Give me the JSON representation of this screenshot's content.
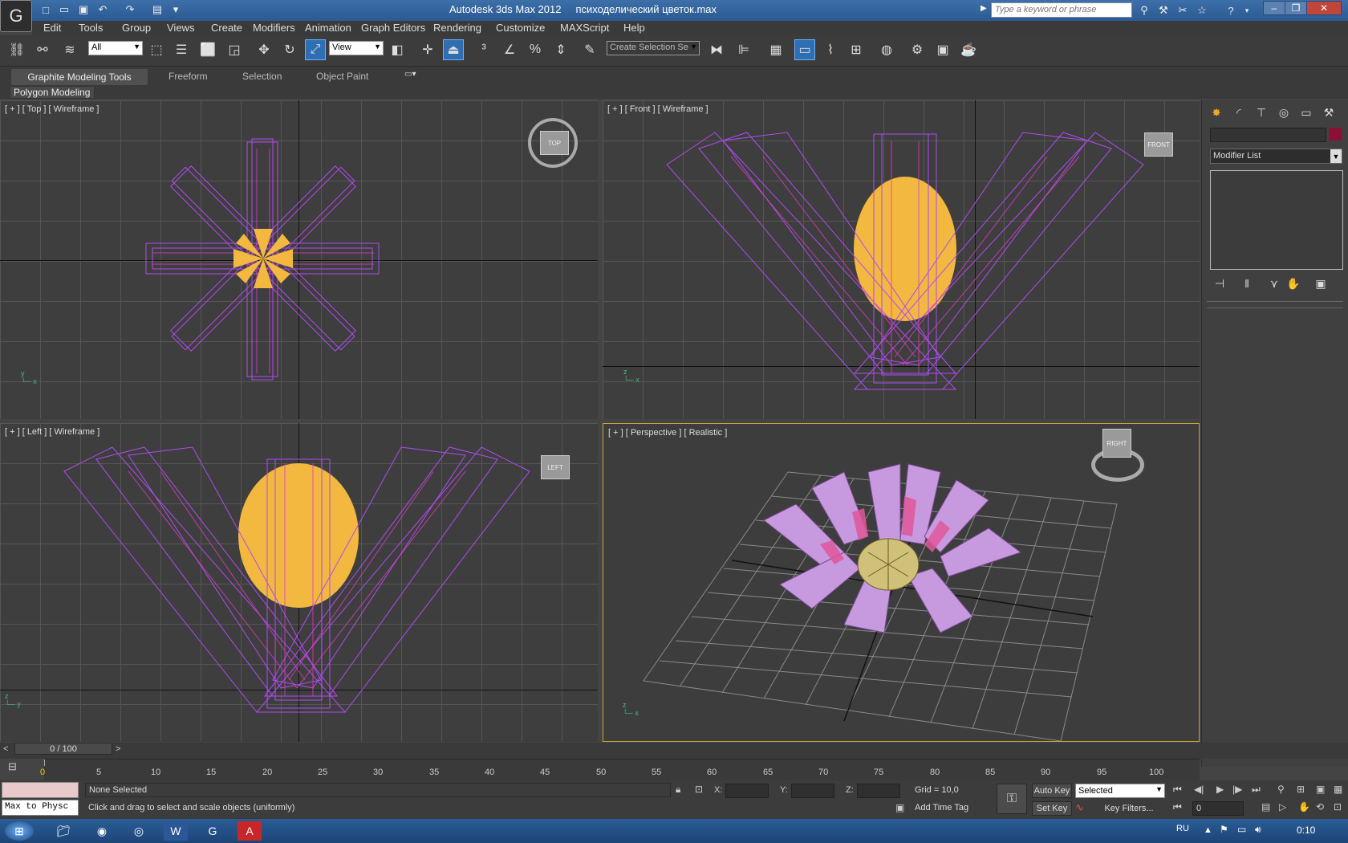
{
  "app": {
    "title": "Autodesk 3ds Max  2012",
    "document": "психоделический цветок.max",
    "search_placeholder": "Type a keyword or phrase"
  },
  "menu": [
    "Edit",
    "Tools",
    "Group",
    "Views",
    "Create",
    "Modifiers",
    "Animation",
    "Graph Editors",
    "Rendering",
    "Customize",
    "MAXScript",
    "Help"
  ],
  "toolbar": {
    "selection_filter": "All",
    "ref_coord": "View",
    "selection_set_placeholder": "Create Selection Se"
  },
  "ribbon": {
    "tabs": [
      "Graphite Modeling Tools",
      "Freeform",
      "Selection",
      "Object Paint"
    ],
    "panel_button": "Polygon Modeling"
  },
  "viewports": {
    "top": {
      "label": "[ + ] [ Top ] [ Wireframe ]",
      "cube": "TOP"
    },
    "front": {
      "label": "[ + ] [ Front ] [ Wireframe ]",
      "cube": "FRONT"
    },
    "left": {
      "label": "[ + ] [ Left ] [ Wireframe ]",
      "cube": "LEFT"
    },
    "perspective": {
      "label": "[ + ] [ Perspective ] [ Realistic ]",
      "cube": "RIGHT"
    }
  },
  "command_panel": {
    "modifier_list": "Modifier List",
    "object_color": "#8b1036"
  },
  "timeline": {
    "frame_display": "0 / 100",
    "ticks": [
      "0",
      "5",
      "10",
      "15",
      "20",
      "25",
      "30",
      "35",
      "40",
      "45",
      "50",
      "55",
      "60",
      "65",
      "70",
      "75",
      "80",
      "85",
      "90",
      "95",
      "100"
    ]
  },
  "status": {
    "selection": "None Selected",
    "prompt": "Click and drag to select and scale objects (uniformly)",
    "maxscript": "Max to Physc",
    "x_label": "X:",
    "y_label": "Y:",
    "z_label": "Z:",
    "grid": "Grid = 10,0",
    "add_time_tag": "Add Time Tag",
    "auto_key": "Auto Key",
    "set_key": "Set Key",
    "key_mode": "Selected",
    "key_filters": "Key Filters...",
    "frame": "0"
  },
  "taskbar": {
    "lang": "RU",
    "clock": "0:10"
  },
  "colors": {
    "wire_purple": "#b04cf0",
    "wire_magenta": "#e03cc8",
    "sphere_yellow": "#f2b840",
    "active_border": "#c8a43c"
  }
}
